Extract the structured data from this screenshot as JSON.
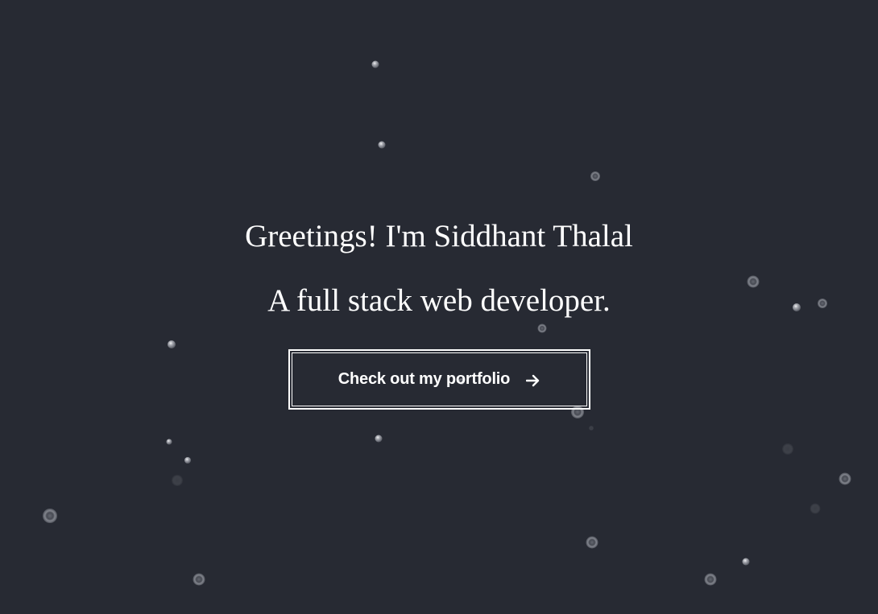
{
  "hero": {
    "greeting": "Greetings! I'm Siddhant Thalal",
    "tagline": "A full stack web developer.",
    "cta_label": "Check out my portfolio",
    "cta_icon": "arrow-right-icon"
  },
  "colors": {
    "background": "#272a33",
    "text": "#ffffff",
    "particle": "#9a9ca4"
  }
}
